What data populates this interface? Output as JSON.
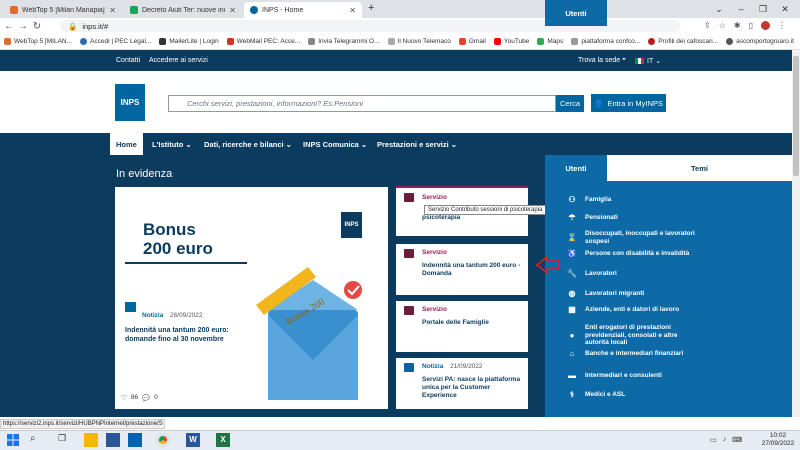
{
  "browser": {
    "tabs": [
      {
        "title": "WebTop 5 [Milan Mariapia]",
        "color": "#e36b2c"
      },
      {
        "title": "Decreto Aiuti Ter: nuove indennità",
        "color": "#1aa35c"
      },
      {
        "title": "INPS - Home",
        "color": "#0066a1"
      }
    ],
    "new_tab": "+",
    "url": "inps.it/#",
    "bookmarks": [
      "WebTop 5 [MILAN...",
      "Accedi | PEC Legal...",
      "MailerLite | Login",
      "WebMail PEC: Acce...",
      "Invia Telegrammi O...",
      "Il Nuovo Telemaco",
      "Gmail",
      "YouTube",
      "Maps",
      "piattaforma confco...",
      "Profili dei cafoscari...",
      "ascomportogruaro.it"
    ]
  },
  "topbar": {
    "links": [
      "Contatti",
      "Accedere ai servizi"
    ],
    "trova": "Trova la sede",
    "lang": "IT"
  },
  "header": {
    "logo": "INPS",
    "search_placeholder": "Cerchi servizi, prestazioni, informazioni? Es.Pensioni",
    "search_button": "Cerca",
    "login_button": "Entra in MyINPS"
  },
  "nav": [
    "Home",
    "L'Istituto",
    "Dati, ricerche e bilanci",
    "INPS Comunica",
    "Prestazioni e servizi"
  ],
  "main": {
    "section_title": "In evidenza",
    "big_card": {
      "line1": "Bonus",
      "line2": "200 euro",
      "badge": "INPS",
      "tag": "Notizia",
      "date": "26/09/2022",
      "title": "Indennità una tantum 200 euro: domande fino al 30 novembre",
      "likes": "86",
      "comments": "0",
      "envelope_text": "Bonus 200"
    },
    "cards": [
      {
        "tag": "Servizio",
        "title": "psicoterapia",
        "tooltip": "Servizio Contributo sessioni di psicoterapia"
      },
      {
        "tag": "Servizio",
        "title": "Indennità una tantum 200 euro - Domanda"
      },
      {
        "tag": "Servizio",
        "title": "Portale delle Famiglie"
      },
      {
        "tag": "Notizia",
        "date": "21/09/2022",
        "title": "Servizi PA: nasce la piattaforma unica per la Customer Experience"
      }
    ]
  },
  "side": {
    "tabs": [
      "Utenti",
      "Temi"
    ],
    "items": [
      {
        "label": "Famiglia",
        "icon": "👨‍👩‍👧"
      },
      {
        "label": "Pensionati",
        "icon": "☂"
      },
      {
        "label": "Disoccupati, inoccupati e lavoratori sospesi",
        "icon": "⌛"
      },
      {
        "label": "Persone con disabilità e invalidità",
        "icon": "♿"
      },
      {
        "label": "Lavoratori",
        "icon": "🔧"
      },
      {
        "label": "Lavoratori migranti",
        "icon": "🌐"
      },
      {
        "label": "Aziende, enti e datori di lavoro",
        "icon": "▦"
      },
      {
        "label": "Enti erogatori di prestazioni previdenziali, consolati e altre autorità locali",
        "icon": "●"
      },
      {
        "label": "Banche e intermediari finanziari",
        "icon": "🏛"
      },
      {
        "label": "Intermediari e consulenti",
        "icon": "▬"
      },
      {
        "label": "Medici e ASL",
        "icon": "⚕"
      }
    ]
  },
  "status_url": "https://servizi2.inps.it/servizi/HUBPNPInternet/prestazione/S",
  "taskbar": {
    "time": "10:02",
    "date": "27/09/2022"
  }
}
